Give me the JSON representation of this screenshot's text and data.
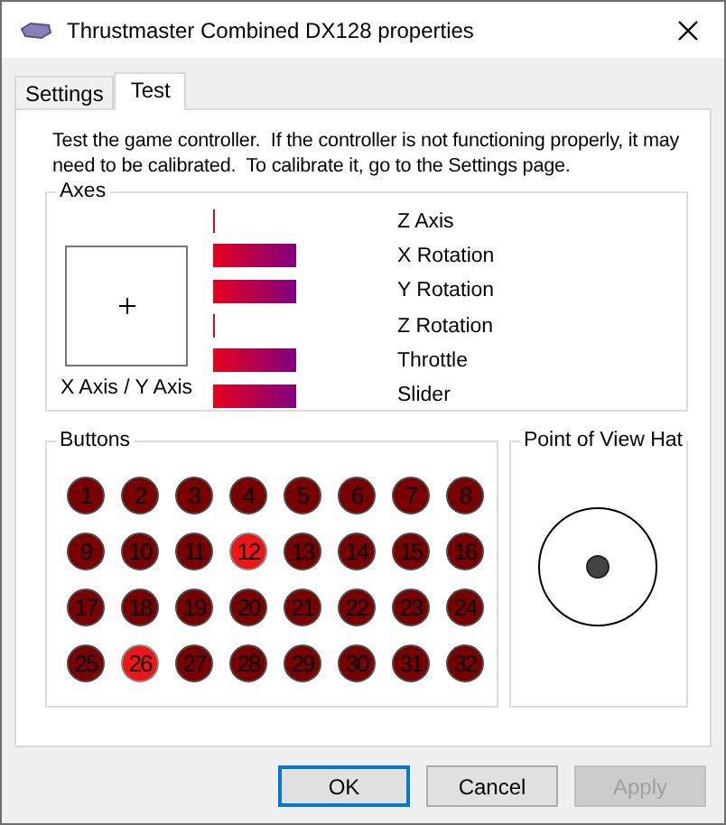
{
  "window": {
    "title": "Thrustmaster Combined DX128 properties"
  },
  "tabs": [
    {
      "label": "Settings",
      "selected": false
    },
    {
      "label": "Test",
      "selected": true
    }
  ],
  "description": "Test the game controller.  If the controller is not functioning properly, it may need to be calibrated.  To calibrate it, go to the Settings page.",
  "axes": {
    "title": "Axes",
    "xy_label": "X Axis / Y Axis",
    "items": [
      {
        "name": "Z Axis",
        "kind": "line"
      },
      {
        "name": "X Rotation",
        "kind": "bar"
      },
      {
        "name": "Y Rotation",
        "kind": "bar"
      },
      {
        "name": "Z Rotation",
        "kind": "line"
      },
      {
        "name": "Throttle",
        "kind": "bar"
      },
      {
        "name": "Slider",
        "kind": "bar"
      }
    ]
  },
  "buttons_group": {
    "title": "Buttons",
    "buttons": [
      {
        "label": "1",
        "pressed": false
      },
      {
        "label": "2",
        "pressed": false
      },
      {
        "label": "3",
        "pressed": false
      },
      {
        "label": "4",
        "pressed": false
      },
      {
        "label": "5",
        "pressed": false
      },
      {
        "label": "6",
        "pressed": false
      },
      {
        "label": "7",
        "pressed": false
      },
      {
        "label": "8",
        "pressed": false
      },
      {
        "label": "9",
        "pressed": false
      },
      {
        "label": "10",
        "pressed": false
      },
      {
        "label": "11",
        "pressed": false
      },
      {
        "label": "12",
        "pressed": true
      },
      {
        "label": "13",
        "pressed": false
      },
      {
        "label": "14",
        "pressed": false
      },
      {
        "label": "15",
        "pressed": false
      },
      {
        "label": "16",
        "pressed": false
      },
      {
        "label": "17",
        "pressed": false
      },
      {
        "label": "18",
        "pressed": false
      },
      {
        "label": "19",
        "pressed": false
      },
      {
        "label": "20",
        "pressed": false
      },
      {
        "label": "21",
        "pressed": false
      },
      {
        "label": "22",
        "pressed": false
      },
      {
        "label": "23",
        "pressed": false
      },
      {
        "label": "24",
        "pressed": false
      },
      {
        "label": "25",
        "pressed": false
      },
      {
        "label": "26",
        "pressed": true
      },
      {
        "label": "27",
        "pressed": false
      },
      {
        "label": "28",
        "pressed": false
      },
      {
        "label": "29",
        "pressed": false
      },
      {
        "label": "30",
        "pressed": false
      },
      {
        "label": "31",
        "pressed": false
      },
      {
        "label": "32",
        "pressed": false
      }
    ]
  },
  "pov": {
    "title": "Point of View Hat"
  },
  "footer_buttons": [
    {
      "label": "OK",
      "default": true,
      "disabled": false
    },
    {
      "label": "Cancel",
      "default": false,
      "disabled": false
    },
    {
      "label": "Apply",
      "default": false,
      "disabled": true
    }
  ]
}
